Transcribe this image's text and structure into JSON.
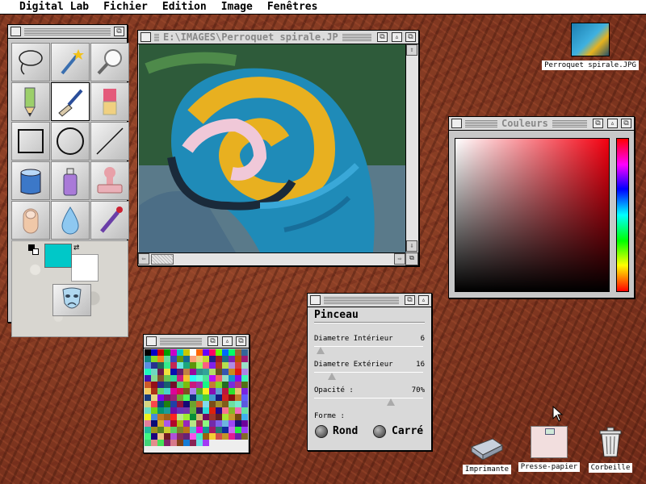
{
  "menubar": {
    "items": [
      "Digital Lab",
      "Fichier",
      "Edition",
      "Image",
      "Fenêtres"
    ]
  },
  "image_window": {
    "title": "E:\\IMAGES\\Perroquet spirale.JP"
  },
  "colors_window": {
    "title": "Couleurs"
  },
  "brush_window": {
    "title": "Pinceau",
    "inner_diameter_label": "Diametre Intérieur",
    "inner_diameter_value": "6",
    "inner_diameter_level": 0.06,
    "outer_diameter_label": "Diametre Extérieur",
    "outer_diameter_value": "16",
    "outer_diameter_level": 0.16,
    "opacity_label": "Opacité :",
    "opacity_value": "70%",
    "opacity_level": 0.7,
    "shape_label": "Forme :",
    "shape_round": "Rond",
    "shape_square": "Carré"
  },
  "tools": {
    "items": [
      "lasso",
      "magic-wand",
      "magnifier",
      "pencil",
      "brush",
      "eraser",
      "rectangle",
      "ellipse",
      "line",
      "paint-bucket",
      "spray-can",
      "stamp",
      "finger-smudge",
      "water-drop",
      "eyedropper"
    ],
    "selected": "brush",
    "foreground_color": "#00c8c8",
    "background_color": "#ffffff"
  },
  "desktop": {
    "file_icon_label": "Perroquet spirale.JPG",
    "printer_label": "Imprimante",
    "clipboard_label": "Presse-papier",
    "trash_label": "Corbeille"
  }
}
